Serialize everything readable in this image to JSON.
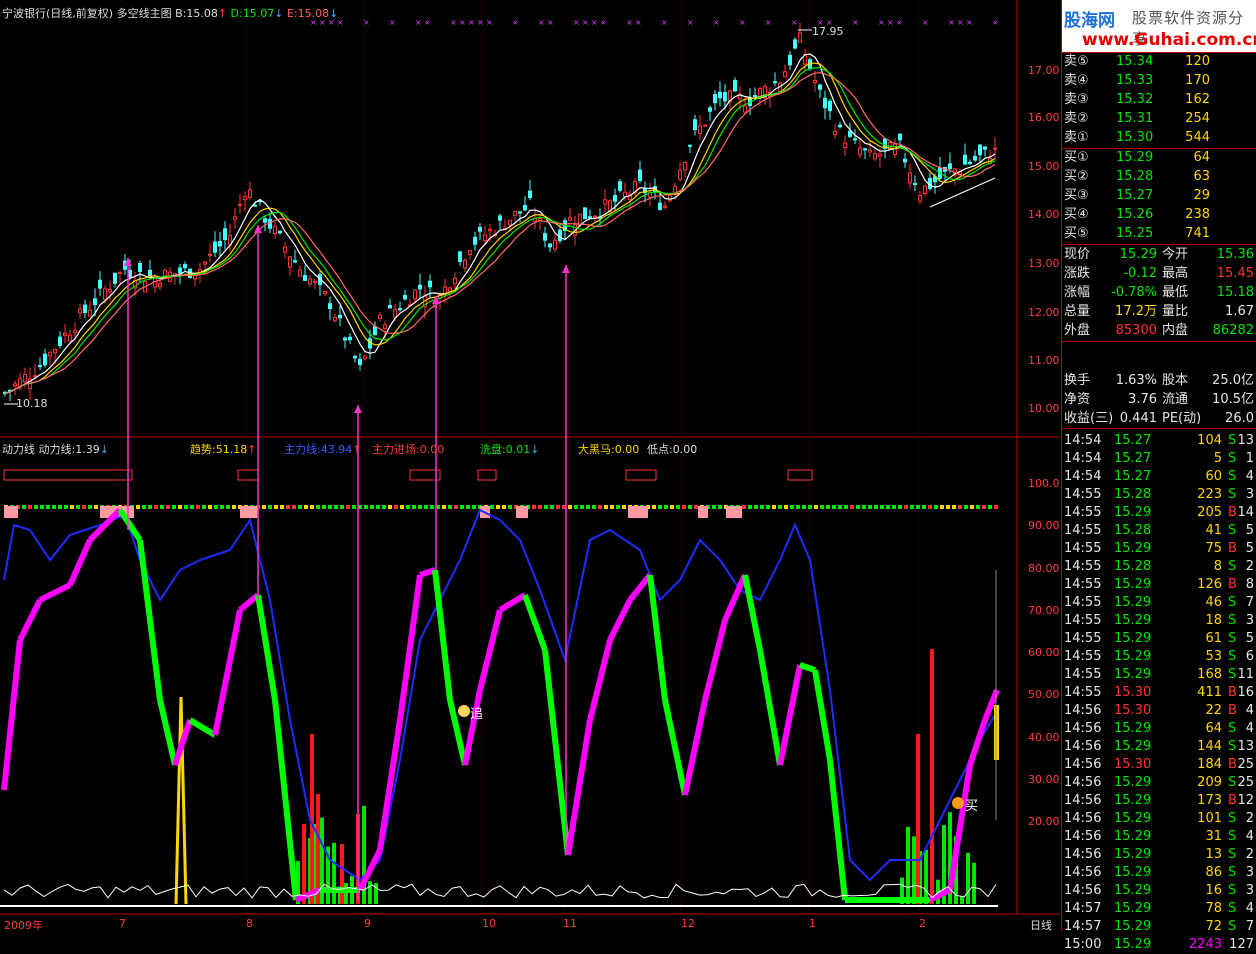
{
  "header_top": {
    "title": "宁波银行(日线,前复权) 多空线主图",
    "b": "B:15.08",
    "d": "D:15.07",
    "e": "E:15.08"
  },
  "header_bottom": {
    "name": "动力线",
    "power": "动力线:1.39",
    "trend": "趋势:51.18",
    "main": "主力线:43.94",
    "enter": "主力进场:0.00",
    "wash": "洗盘:0.01",
    "horse": "大黑马:0.00",
    "low": "低点:0.00"
  },
  "labels": {
    "high": "17.95",
    "low": "10.18",
    "chase": "追",
    "buy": "买"
  },
  "price_axis": [
    "17.00",
    "16.00",
    "15.00",
    "14.00",
    "13.00",
    "12.00",
    "11.00",
    "10.00"
  ],
  "ind_axis": [
    "100.0",
    "90.00",
    "80.00",
    "70.00",
    "60.00",
    "50.00",
    "40.00",
    "30.00",
    "20.00"
  ],
  "date_axis": [
    "2009年",
    "7",
    "8",
    "9",
    "10",
    "11",
    "12",
    "1",
    "2"
  ],
  "date_unit": "日线",
  "logo": {
    "brand": "股海网",
    "slogan": "股票软件资源分享",
    "url": "www.Guhai.com.cn"
  },
  "asks": [
    {
      "label": "卖⑤",
      "price": "15.34",
      "vol": "120"
    },
    {
      "label": "卖④",
      "price": "15.33",
      "vol": "170"
    },
    {
      "label": "卖③",
      "price": "15.32",
      "vol": "162"
    },
    {
      "label": "卖②",
      "price": "15.31",
      "vol": "254"
    },
    {
      "label": "卖①",
      "price": "15.30",
      "vol": "544"
    }
  ],
  "bids": [
    {
      "label": "买①",
      "price": "15.29",
      "vol": "64"
    },
    {
      "label": "买②",
      "price": "15.28",
      "vol": "63"
    },
    {
      "label": "买③",
      "price": "15.27",
      "vol": "29"
    },
    {
      "label": "买④",
      "price": "15.26",
      "vol": "238"
    },
    {
      "label": "买⑤",
      "price": "15.25",
      "vol": "741"
    }
  ],
  "quote": [
    {
      "k1": "现价",
      "v1": "15.29",
      "c1": "g",
      "k2": "今开",
      "v2": "15.36",
      "c2": "g"
    },
    {
      "k1": "涨跌",
      "v1": "-0.12",
      "c1": "g",
      "k2": "最高",
      "v2": "15.45",
      "c2": "r"
    },
    {
      "k1": "涨幅",
      "v1": "-0.78%",
      "c1": "g",
      "k2": "最低",
      "v2": "15.18",
      "c2": "g"
    },
    {
      "k1": "总量",
      "v1": "17.2万",
      "c1": "y",
      "k2": "量比",
      "v2": "1.67",
      "c2": "w"
    },
    {
      "k1": "外盘",
      "v1": "85300",
      "c1": "r",
      "k2": "内盘",
      "v2": "86282",
      "c2": "g"
    }
  ],
  "finance": [
    {
      "k1": "换手",
      "v1": "1.63%",
      "k2": "股本",
      "v2": "25.0亿"
    },
    {
      "k1": "净资",
      "v1": "3.76",
      "k2": "流通",
      "v2": "10.5亿"
    },
    {
      "k1": "收益(三)",
      "v1": "0.441",
      "k2": "PE(动)",
      "v2": "26.0"
    }
  ],
  "ticks": [
    [
      "14:54",
      "15.27",
      "104",
      "S",
      "13"
    ],
    [
      "14:54",
      "15.27",
      "5",
      "S",
      "1"
    ],
    [
      "14:54",
      "15.27",
      "60",
      "S",
      "4"
    ],
    [
      "14:55",
      "15.28",
      "223",
      "S",
      "3"
    ],
    [
      "14:55",
      "15.29",
      "205",
      "B",
      "14"
    ],
    [
      "14:55",
      "15.28",
      "41",
      "S",
      "5"
    ],
    [
      "14:55",
      "15.29",
      "75",
      "B",
      "5"
    ],
    [
      "14:55",
      "15.28",
      "8",
      "S",
      "2"
    ],
    [
      "14:55",
      "15.29",
      "126",
      "B",
      "8"
    ],
    [
      "14:55",
      "15.29",
      "46",
      "S",
      "7"
    ],
    [
      "14:55",
      "15.29",
      "18",
      "S",
      "3"
    ],
    [
      "14:55",
      "15.29",
      "61",
      "S",
      "5"
    ],
    [
      "14:55",
      "15.29",
      "53",
      "S",
      "6"
    ],
    [
      "14:55",
      "15.29",
      "168",
      "S",
      "11"
    ],
    [
      "14:55",
      "15.30",
      "411",
      "B",
      "16"
    ],
    [
      "14:56",
      "15.30",
      "22",
      "B",
      "4"
    ],
    [
      "14:56",
      "15.29",
      "64",
      "S",
      "4"
    ],
    [
      "14:56",
      "15.29",
      "144",
      "S",
      "13"
    ],
    [
      "14:56",
      "15.30",
      "184",
      "B",
      "25"
    ],
    [
      "14:56",
      "15.29",
      "209",
      "S",
      "25"
    ],
    [
      "14:56",
      "15.29",
      "173",
      "B",
      "12"
    ],
    [
      "14:56",
      "15.29",
      "101",
      "S",
      "2"
    ],
    [
      "14:56",
      "15.29",
      "31",
      "S",
      "4"
    ],
    [
      "14:56",
      "15.29",
      "13",
      "S",
      "2"
    ],
    [
      "14:56",
      "15.29",
      "86",
      "S",
      "3"
    ],
    [
      "14:56",
      "15.29",
      "16",
      "S",
      "3"
    ],
    [
      "14:57",
      "15.29",
      "78",
      "S",
      "4"
    ],
    [
      "14:57",
      "15.29",
      "72",
      "S",
      "7"
    ],
    [
      "15:00",
      "15.29",
      "2243",
      "",
      "127"
    ]
  ]
}
